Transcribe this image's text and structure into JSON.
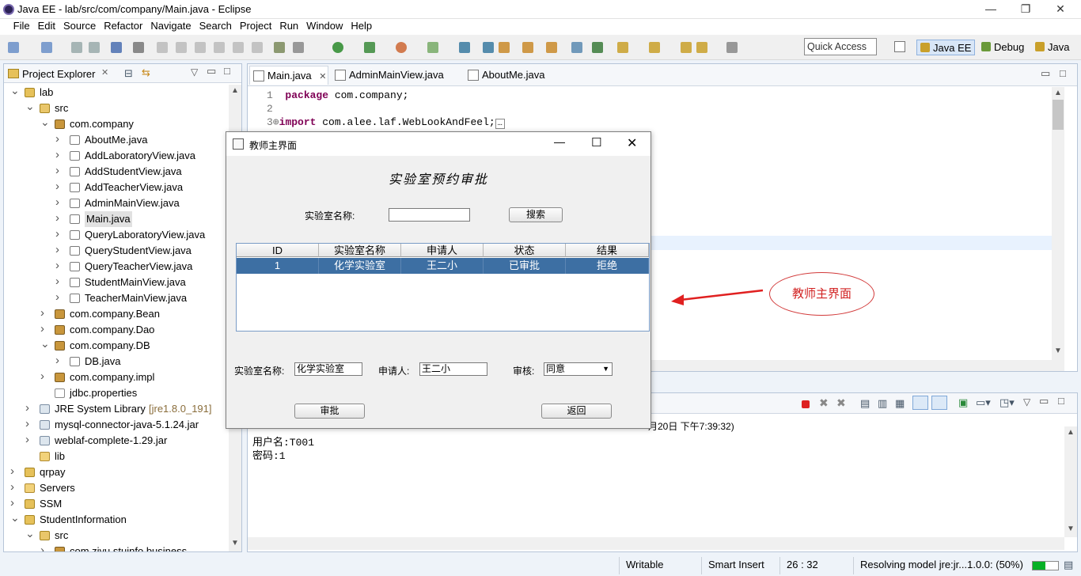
{
  "window": {
    "title": "Java EE - lab/src/com/company/Main.java - Eclipse",
    "minimize_icon": "minimize-icon",
    "restore_icon": "restore-icon",
    "close_icon": "close-icon"
  },
  "menu": [
    "File",
    "Edit",
    "Source",
    "Refactor",
    "Navigate",
    "Search",
    "Project",
    "Run",
    "Window",
    "Help"
  ],
  "toolbar": {
    "quick_access": "Quick Access",
    "perspectives": [
      "Java EE",
      "Debug",
      "Java"
    ]
  },
  "explorer": {
    "title": "Project Explorer",
    "items": [
      {
        "label": "lab",
        "depth": 0,
        "expanded": true,
        "icon": "project"
      },
      {
        "label": "src",
        "depth": 1,
        "expanded": true,
        "icon": "src"
      },
      {
        "label": "com.company",
        "depth": 2,
        "expanded": true,
        "icon": "package"
      },
      {
        "label": "AboutMe.java",
        "depth": 3,
        "expanded": false,
        "icon": "java"
      },
      {
        "label": "AddLaboratoryView.java",
        "depth": 3,
        "expanded": false,
        "icon": "java"
      },
      {
        "label": "AddStudentView.java",
        "depth": 3,
        "expanded": false,
        "icon": "java"
      },
      {
        "label": "AddTeacherView.java",
        "depth": 3,
        "expanded": false,
        "icon": "java"
      },
      {
        "label": "AdminMainView.java",
        "depth": 3,
        "expanded": false,
        "icon": "java"
      },
      {
        "label": "Main.java",
        "depth": 3,
        "expanded": false,
        "icon": "java",
        "selected": true
      },
      {
        "label": "QueryLaboratoryView.java",
        "depth": 3,
        "expanded": false,
        "icon": "java"
      },
      {
        "label": "QueryStudentView.java",
        "depth": 3,
        "expanded": false,
        "icon": "java"
      },
      {
        "label": "QueryTeacherView.java",
        "depth": 3,
        "expanded": false,
        "icon": "java"
      },
      {
        "label": "StudentMainView.java",
        "depth": 3,
        "expanded": false,
        "icon": "java"
      },
      {
        "label": "TeacherMainView.java",
        "depth": 3,
        "expanded": false,
        "icon": "java"
      },
      {
        "label": "com.company.Bean",
        "depth": 2,
        "expanded": false,
        "icon": "package"
      },
      {
        "label": "com.company.Dao",
        "depth": 2,
        "expanded": false,
        "icon": "package"
      },
      {
        "label": "com.company.DB",
        "depth": 2,
        "expanded": true,
        "icon": "package"
      },
      {
        "label": "DB.java",
        "depth": 3,
        "expanded": false,
        "icon": "java"
      },
      {
        "label": "com.company.impl",
        "depth": 2,
        "expanded": false,
        "icon": "package"
      },
      {
        "label": "jdbc.properties",
        "depth": 2,
        "expanded": null,
        "icon": "prop"
      },
      {
        "label": "JRE System Library",
        "suffix": "[jre1.8.0_191]",
        "depth": 1,
        "expanded": false,
        "icon": "jar"
      },
      {
        "label": "mysql-connector-java-5.1.24.jar",
        "depth": 1,
        "expanded": false,
        "icon": "jar"
      },
      {
        "label": "weblaf-complete-1.29.jar",
        "depth": 1,
        "expanded": false,
        "icon": "jar"
      },
      {
        "label": "lib",
        "depth": 1,
        "expanded": null,
        "icon": "folder"
      },
      {
        "label": "qrpay",
        "depth": 0,
        "expanded": false,
        "icon": "project"
      },
      {
        "label": "Servers",
        "depth": 0,
        "expanded": false,
        "icon": "folder"
      },
      {
        "label": "SSM",
        "depth": 0,
        "expanded": false,
        "icon": "project"
      },
      {
        "label": "StudentInformation",
        "depth": 0,
        "expanded": true,
        "icon": "project"
      },
      {
        "label": "src",
        "depth": 1,
        "expanded": true,
        "icon": "src"
      },
      {
        "label": "com.ziyu.stuinfo.business",
        "depth": 2,
        "expanded": false,
        "icon": "package"
      }
    ]
  },
  "editor": {
    "tabs": [
      "Main.java",
      "AdminMainView.java",
      "AboutMe.java"
    ],
    "lines": [
      {
        "num": "1",
        "kw": "package",
        "rest": " com.company;"
      },
      {
        "num": "2",
        "kw": "",
        "rest": ""
      },
      {
        "num": "3⊕",
        "kw": "import",
        "rest": " com.alee.laf.WebLookAndFeel;"
      }
    ]
  },
  "console": {
    "header_line": "月20日 下午7:39:32)",
    "lines": [
      "用户名:T001",
      "密码:1"
    ]
  },
  "status": {
    "writable": "Writable",
    "insert": "Smart Insert",
    "position": "26 : 32",
    "task": "Resolving model jre:jr...1.0.0: (50%)",
    "progress": 0.5
  },
  "dialog": {
    "title": "教师主界面",
    "heading": "实验室预约审批",
    "search_label": "实验室名称:",
    "search_value": "",
    "search_button": "搜索",
    "table": {
      "columns": [
        "ID",
        "实验室名称",
        "申请人",
        "状态",
        "结果"
      ],
      "rows": [
        [
          "1",
          "化学实验室",
          "王二小",
          "已审批",
          "拒绝"
        ]
      ]
    },
    "lab_label": "实验室名称:",
    "lab_value": "化学实验室",
    "applicant_label": "申请人:",
    "applicant_value": "王二小",
    "review_label": "审核:",
    "review_value": "同意",
    "approve_button": "审批",
    "back_button": "返回"
  },
  "annotation": {
    "label": "教师主界面",
    "color": "#d22323"
  }
}
